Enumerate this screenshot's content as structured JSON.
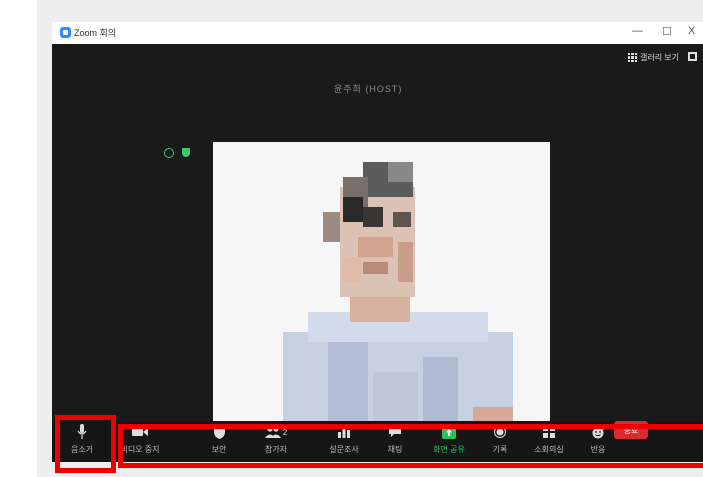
{
  "window": {
    "title": "Zoom 회의",
    "minimize": "—",
    "maximize": "☐",
    "close": "X"
  },
  "meeting": {
    "participant_name": "윤주희 (HOST)",
    "gallery_view_label": "갤러리 보기"
  },
  "toolbar": {
    "mute_label": "음소거",
    "video_label": "비디오 중지",
    "security_label": "보안",
    "participants_label": "참가자",
    "participants_count": "2",
    "polls_label": "설문조사",
    "chat_label": "채팅",
    "share_label": "화면 공유",
    "record_label": "기록",
    "breakout_label": "소회의실",
    "reactions_label": "반응",
    "end_label": "종료"
  },
  "colors": {
    "accent_green": "#29c35b",
    "end_red": "#d82b30",
    "highlight_red": "#ee0000",
    "zoom_blue": "#2d8cff"
  },
  "icons": [
    "microphone-icon",
    "video-camera-icon",
    "shield-icon",
    "participants-icon",
    "polls-icon",
    "chat-icon",
    "share-screen-icon",
    "record-icon",
    "breakout-rooms-icon",
    "reactions-icon",
    "grid-icon",
    "fullscreen-icon",
    "info-icon"
  ]
}
